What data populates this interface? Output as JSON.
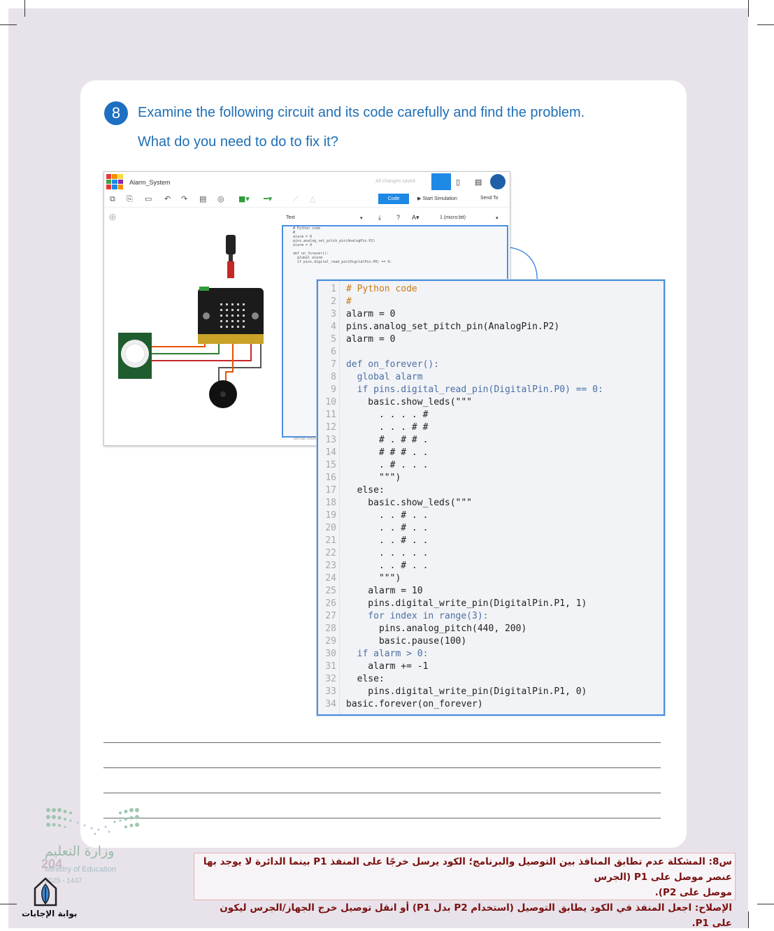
{
  "question": {
    "number": "8",
    "line1": "Examine the following circuit and its code carefully and find the problem.",
    "line2": "What do you need to do to fix it?"
  },
  "editor": {
    "project_title": "Alarm_System",
    "status_text": "All changes saved",
    "code_button": "Code",
    "start_simulation": "Start Simulation",
    "send_to": "Send To",
    "mode_select": "Text",
    "device_select": "1 (micro:bit)",
    "serial_monitor": "Serial Monitor"
  },
  "code_lines": [
    {
      "n": "1",
      "t": "# Python code"
    },
    {
      "n": "2",
      "t": "#"
    },
    {
      "n": "3",
      "t": "alarm = 0"
    },
    {
      "n": "4",
      "t": "pins.analog_set_pitch_pin(AnalogPin.P2)"
    },
    {
      "n": "5",
      "t": "alarm = 0"
    },
    {
      "n": "6",
      "t": ""
    },
    {
      "n": "7",
      "t": "def on_forever():"
    },
    {
      "n": "8",
      "t": "  global alarm"
    },
    {
      "n": "9",
      "t": "  if pins.digital_read_pin(DigitalPin.P0) == 0:"
    },
    {
      "n": "10",
      "t": "    basic.show_leds(\"\"\""
    },
    {
      "n": "11",
      "t": "      . . . . #"
    },
    {
      "n": "12",
      "t": "      . . . # #"
    },
    {
      "n": "13",
      "t": "      # . # # ."
    },
    {
      "n": "14",
      "t": "      # # # . ."
    },
    {
      "n": "15",
      "t": "      . # . . ."
    },
    {
      "n": "16",
      "t": "      \"\"\")"
    },
    {
      "n": "17",
      "t": "  else:"
    },
    {
      "n": "18",
      "t": "    basic.show_leds(\"\"\""
    },
    {
      "n": "19",
      "t": "      . . # . ."
    },
    {
      "n": "20",
      "t": "      . . # . ."
    },
    {
      "n": "21",
      "t": "      . . # . ."
    },
    {
      "n": "22",
      "t": "      . . . . ."
    },
    {
      "n": "23",
      "t": "      . . # . ."
    },
    {
      "n": "24",
      "t": "      \"\"\")"
    },
    {
      "n": "25",
      "t": "    alarm = 10"
    },
    {
      "n": "26",
      "t": "    pins.digital_write_pin(DigitalPin.P1, 1)"
    },
    {
      "n": "27",
      "t": "    for index in range(3):"
    },
    {
      "n": "28",
      "t": "      pins.analog_pitch(440, 200)"
    },
    {
      "n": "29",
      "t": "      basic.pause(100)"
    },
    {
      "n": "30",
      "t": "  if alarm > 0:"
    },
    {
      "n": "31",
      "t": "    alarm += -1"
    },
    {
      "n": "32",
      "t": "  else:"
    },
    {
      "n": "33",
      "t": "    pins.digital_write_pin(DigitalPin.P1, 0)"
    },
    {
      "n": "34",
      "t": "basic.forever(on_forever)"
    }
  ],
  "answer": {
    "line1": "س8: المشكلة عدم تطابق المنافذ بين التوصيل والبرنامج؛ الكود يرسل خرجًا على المنفذ P1 بينما الدائرة لا يوجد بها عنصر موصل على P1 (الجرس",
    "line2": "موصل على P2).",
    "line3": "الإصلاح: اجعل المنفذ في الكود يطابق التوصيل (استخدام P2 بدل P1) أو انقل توصيل خرج الجهاز/الجرس ليكون على P1."
  },
  "footer": {
    "ministry_ar": "وزارة التعليم",
    "ministry_en": "Ministry of Education",
    "year": "2025 - 1447",
    "page_number": "204",
    "site_label": "بوابة الإجابات"
  },
  "colors": {
    "accent": "#1f6fb5",
    "code_border": "#4a8fe0",
    "answer_text": "#7a1010",
    "page_background": "#e8e3ea"
  }
}
